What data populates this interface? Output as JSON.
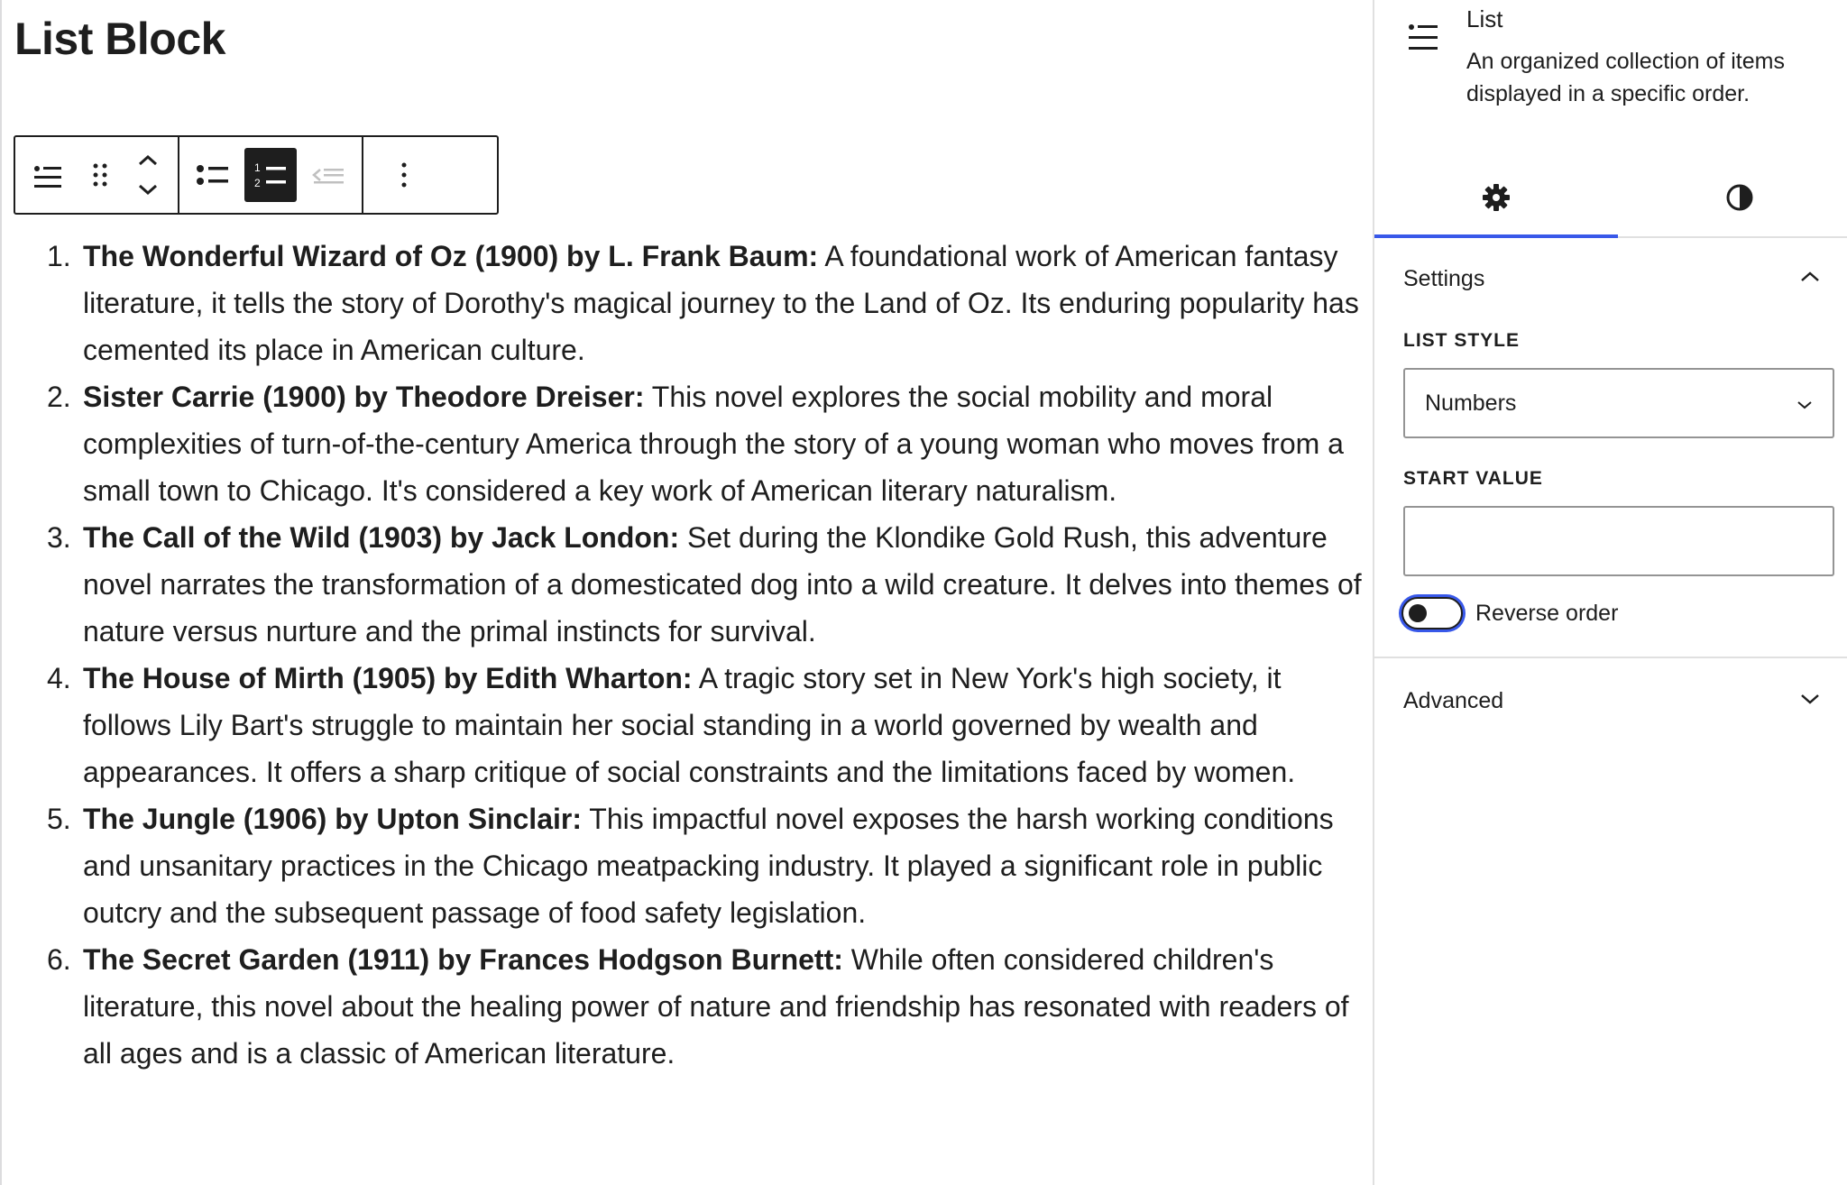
{
  "editor": {
    "title": "List Block",
    "toolbar": {
      "block_icon": "list-block-icon",
      "drag_icon": "drag-handle-icon",
      "move_up_icon": "chevron-up-icon",
      "move_down_icon": "chevron-down-icon",
      "unordered_icon": "unordered-list-icon",
      "ordered_icon": "ordered-list-icon",
      "outdent_icon": "outdent-icon",
      "options_icon": "more-vertical-icon",
      "active_button": "ordered-list"
    },
    "list_items": [
      {
        "number": "1.",
        "bold": "The Wonderful Wizard of Oz (1900) by L. Frank Baum:",
        "text": " A foundational work of American fantasy literature, it tells the story of Dorothy's magical journey to the Land of Oz. Its enduring popularity has cemented its place in American culture."
      },
      {
        "number": "2.",
        "bold": "Sister Carrie (1900) by Theodore Dreiser:",
        "text": " This novel explores the social mobility and moral complexities of turn-of-the-century America through the story of a young woman who moves from a small town to Chicago. It's considered a key work of American literary naturalism."
      },
      {
        "number": "3.",
        "bold": "The Call of the Wild (1903) by Jack London:",
        "text": " Set during the Klondike Gold Rush, this adventure novel narrates the transformation of a domesticated dog into a wild creature. It delves into themes of nature versus nurture and the primal instincts for survival."
      },
      {
        "number": "4.",
        "bold": "The House of Mirth (1905) by Edith Wharton:",
        "text": " A tragic story set in New York's high society, it follows Lily Bart's struggle to maintain her social standing in a world governed by wealth and appearances. It offers a sharp critique of social constraints and the limitations faced by women."
      },
      {
        "number": "5.",
        "bold": "The Jungle (1906) by Upton Sinclair:",
        "text": " This impactful novel exposes the harsh working conditions and unsanitary practices in the Chicago meatpacking industry. It played a significant role in public outcry and the subsequent passage of food safety legislation."
      },
      {
        "number": "6.",
        "bold": "The Secret Garden (1911) by Frances Hodgson Burnett:",
        "text": " While often considered children's literature, this novel about the healing power of nature and friendship has resonated with readers of all ages and is a classic of American literature."
      }
    ]
  },
  "sidebar": {
    "block_card": {
      "icon": "list-block-icon",
      "title": "List",
      "description": "An organized collection of items displayed in a specific order."
    },
    "tabs": [
      {
        "name": "settings",
        "icon": "gear-icon",
        "active": true
      },
      {
        "name": "styles",
        "icon": "contrast-icon",
        "active": false
      }
    ],
    "settings_panel": {
      "title": "Settings",
      "expanded": true,
      "list_style_label": "LIST STYLE",
      "list_style_value": "Numbers",
      "start_value_label": "START VALUE",
      "start_value": "",
      "reverse_order_label": "Reverse order",
      "reverse_order_on": false
    },
    "advanced_panel": {
      "title": "Advanced",
      "expanded": false
    }
  },
  "colors": {
    "text": "#1e1e1e",
    "accent": "#3858e9",
    "border": "#e0e0e0"
  }
}
